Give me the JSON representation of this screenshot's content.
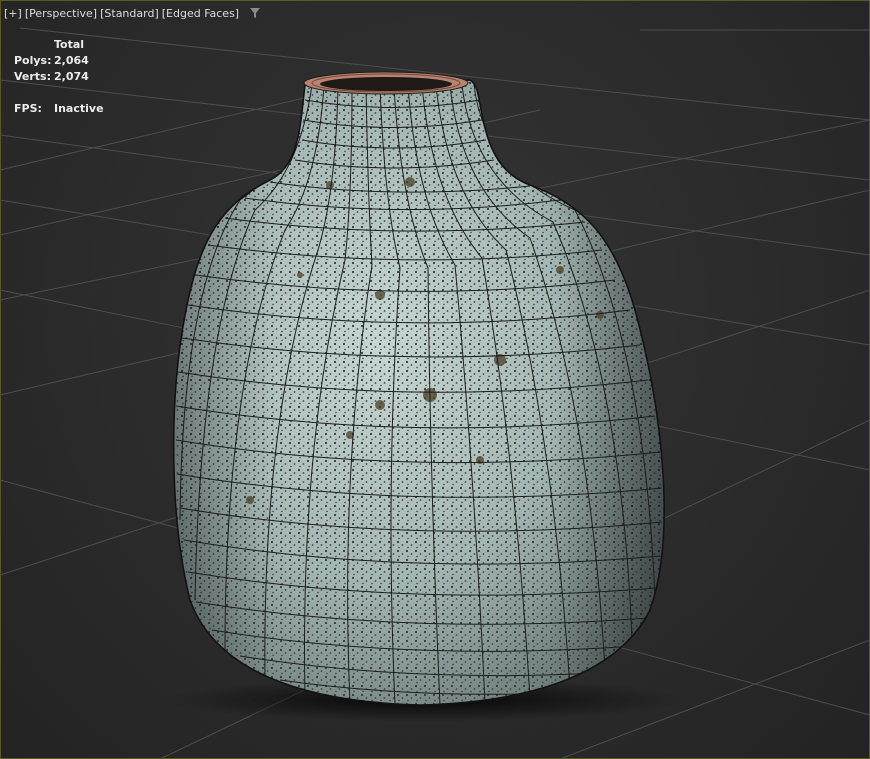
{
  "viewport": {
    "label": {
      "plus": "[+]",
      "view": "[Perspective]",
      "shading_style": "[Standard]",
      "display_mode": "[Edged Faces]",
      "filter_icon": "funnel-icon"
    },
    "stats": {
      "header": "Total",
      "polys_label": "Polys:",
      "polys_value": "2,064",
      "verts_label": "Verts:",
      "verts_value": "2,074",
      "fps_label": "FPS:",
      "fps_value": "Inactive"
    }
  },
  "colors": {
    "background": "#2b2b2b",
    "grid": "#4d4d4d",
    "vase_glaze": "#a9bcb9",
    "wire": "#1c1c1c",
    "rim": "#a06a58",
    "active_border": "#5a5a20"
  }
}
